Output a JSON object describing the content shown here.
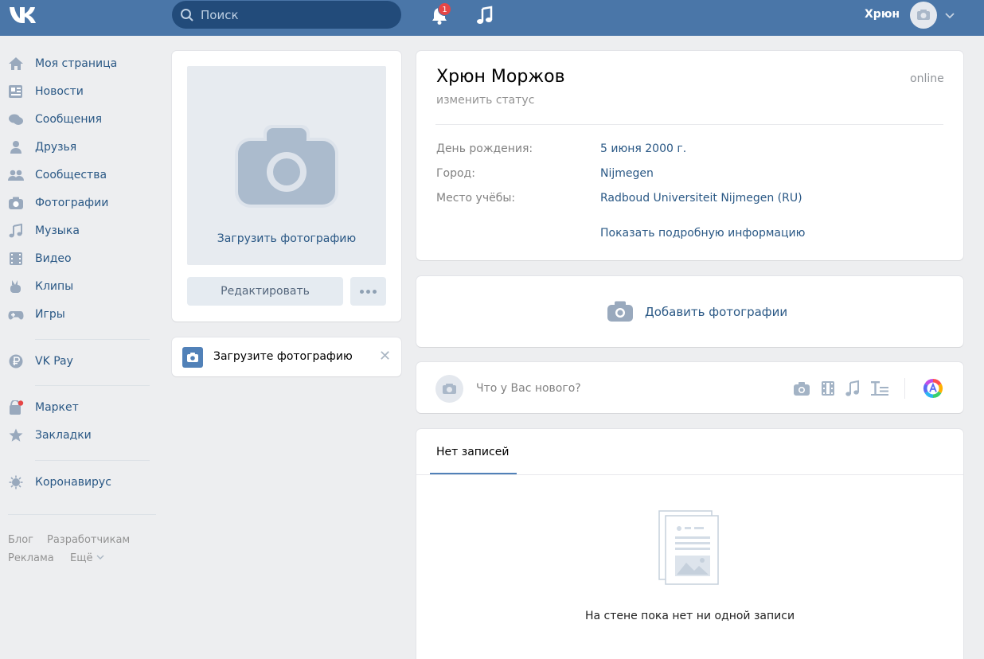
{
  "topbar": {
    "search_placeholder": "Поиск",
    "notification_count": "1",
    "username": "Хрюн",
    "icons": [
      "vk-logo-icon",
      "search-icon",
      "bell-icon",
      "music-note-icon",
      "camera-icon",
      "chevron-down-icon"
    ]
  },
  "sidebar": {
    "items": [
      {
        "label": "Моя страница",
        "icon": "home-icon"
      },
      {
        "label": "Новости",
        "icon": "news-icon"
      },
      {
        "label": "Сообщения",
        "icon": "messages-icon"
      },
      {
        "label": "Друзья",
        "icon": "friend-icon"
      },
      {
        "label": "Сообщества",
        "icon": "groups-icon"
      },
      {
        "label": "Фотографии",
        "icon": "camera-icon"
      },
      {
        "label": "Музыка",
        "icon": "music-note-icon"
      },
      {
        "label": "Видео",
        "icon": "film-icon"
      },
      {
        "label": "Клипы",
        "icon": "clips-icon"
      },
      {
        "label": "Игры",
        "icon": "gamepad-icon"
      },
      {
        "label": "VK Pay",
        "icon": "ruble-icon"
      },
      {
        "label": "Маркет",
        "icon": "bag-icon"
      },
      {
        "label": "Закладки",
        "icon": "star-icon"
      },
      {
        "label": "Коронавирус",
        "icon": "virus-icon"
      }
    ],
    "footer": {
      "blog": "Блог",
      "developers": "Разработчикам",
      "ads": "Реклама",
      "more": "Ещё"
    }
  },
  "left_column": {
    "upload_photo_label": "Загрузить фотографию",
    "edit_button": "Редактировать",
    "upload_notice": "Загрузите фотографию"
  },
  "profile": {
    "name": "Хрюн Моржов",
    "online_status": "online",
    "change_status": "изменить статус",
    "info": [
      {
        "label": "День рождения:",
        "value": "5 июня 2000 г."
      },
      {
        "label": "Город:",
        "value": "Nijmegen"
      },
      {
        "label": "Место учёбы:",
        "value": "Radboud Universiteit Nijmegen (RU)"
      }
    ],
    "show_details": "Показать подробную информацию"
  },
  "photos": {
    "add_label": "Добавить фотографии"
  },
  "composer": {
    "placeholder": "Что у Вас нового?"
  },
  "wall": {
    "tab_label": "Нет записей",
    "empty_text": "На стене пока нет ни одной записи"
  },
  "colors": {
    "header": "#4a76a8",
    "link": "#2a5885",
    "page_bg": "#edeef0",
    "badge": "#e64646"
  }
}
